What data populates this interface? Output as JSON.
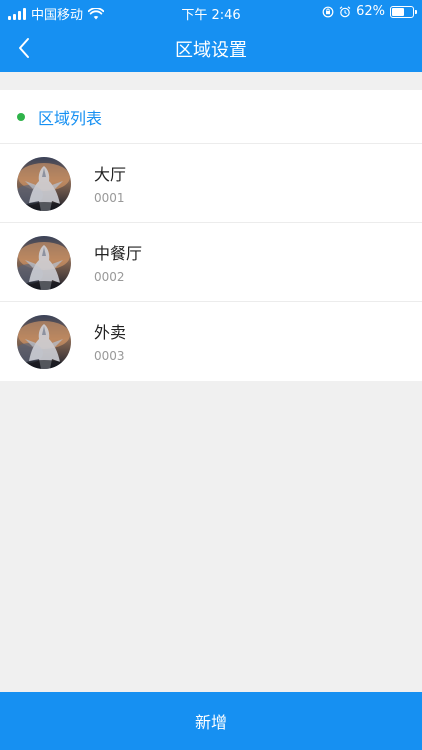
{
  "status_bar": {
    "carrier": "中国移动",
    "time": "下午 2:46",
    "battery_percent": "62%",
    "battery_level": 0.62,
    "icons": [
      "signal-icon",
      "wifi-icon",
      "lock-rotation-icon",
      "alarm-icon",
      "battery-icon"
    ]
  },
  "nav": {
    "title": "区域设置",
    "back_icon": "chevron-left-icon"
  },
  "section": {
    "title": "区域列表",
    "dot_color": "#2fb34a"
  },
  "areas": [
    {
      "name": "大厅",
      "code": "0001",
      "avatar": "avatar-image"
    },
    {
      "name": "中餐厅",
      "code": "0002",
      "avatar": "avatar-image"
    },
    {
      "name": "外卖",
      "code": "0003",
      "avatar": "avatar-image"
    }
  ],
  "footer": {
    "add_label": "新增"
  },
  "colors": {
    "primary": "#1690f2",
    "background": "#f0f0f0",
    "text_primary": "#222222",
    "text_secondary": "#999999"
  }
}
